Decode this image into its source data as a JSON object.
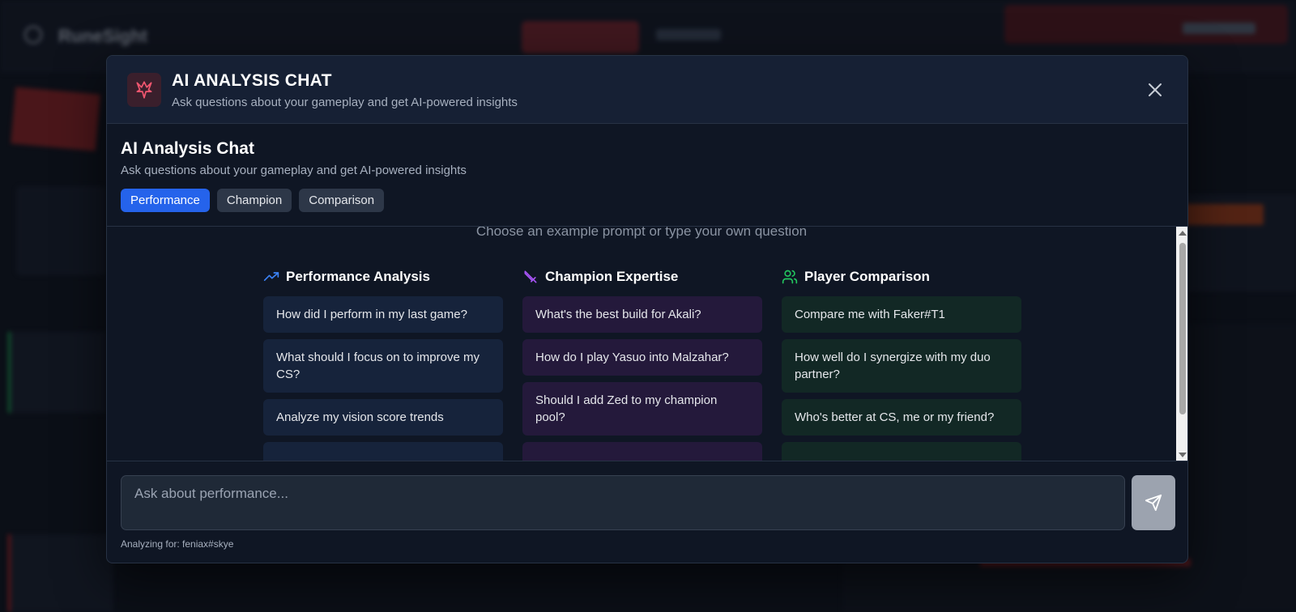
{
  "background_app": {
    "brand": "RuneSight"
  },
  "modal": {
    "header": {
      "title": "AI ANALYSIS CHAT",
      "subtitle": "Ask questions about your gameplay and get AI-powered insights"
    },
    "chat": {
      "title": "AI Analysis Chat",
      "subtitle": "Ask questions about your gameplay and get AI-powered insights",
      "tabs": [
        {
          "label": "Performance",
          "active": true
        },
        {
          "label": "Champion",
          "active": false
        },
        {
          "label": "Comparison",
          "active": false
        }
      ],
      "hint": "Choose an example prompt or type your own question",
      "columns": [
        {
          "title": "Performance Analysis",
          "icon": "trending-up-icon",
          "color": "#3b82f6",
          "prompts": [
            "How did I perform in my last game?",
            "What should I focus on to improve my CS?",
            "Analyze my vision score trends"
          ]
        },
        {
          "title": "Champion Expertise",
          "icon": "sword-icon",
          "color": "#a855f7",
          "prompts": [
            "What's the best build for Akali?",
            "How do I play Yasuo into Malzahar?",
            "Should I add Zed to my champion pool?"
          ]
        },
        {
          "title": "Player Comparison",
          "icon": "users-icon",
          "color": "#22c55e",
          "prompts": [
            "Compare me with Faker#T1",
            "How well do I synergize with my duo partner?",
            "Who's better at CS, me or my friend?"
          ]
        }
      ]
    },
    "input": {
      "placeholder": "Ask about performance...",
      "value": "",
      "analyzing_for": "Analyzing for: feniax#skye"
    }
  },
  "colors": {
    "accent": "#2563eb",
    "modal_bg": "#0f1624",
    "header_bg": "#162034"
  }
}
